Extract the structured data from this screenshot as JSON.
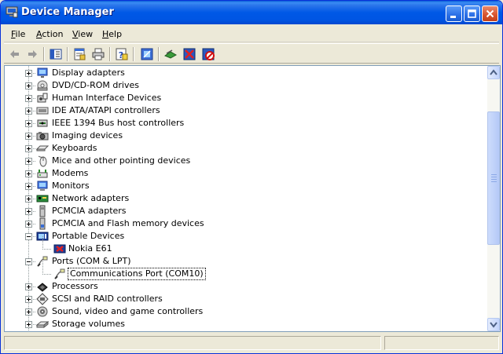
{
  "window": {
    "title": "Device Manager",
    "icon": "device-manager-icon",
    "controls": [
      "minimize",
      "maximize",
      "close"
    ]
  },
  "menu": [
    {
      "label": "File",
      "accel": "F",
      "rest": "ile"
    },
    {
      "label": "Action",
      "accel": "A",
      "rest": "ction"
    },
    {
      "label": "View",
      "accel": "V",
      "rest": "iew"
    },
    {
      "label": "Help",
      "accel": "H",
      "rest": "elp"
    }
  ],
  "toolbar": {
    "buttons": [
      "back-icon",
      "forward-icon",
      "show-hide-console-tree-icon",
      "properties-icon",
      "print-icon",
      "help-icon",
      "scan-hardware-icon",
      "update-driver-icon",
      "uninstall-icon",
      "disable-icon"
    ]
  },
  "tree": {
    "items": [
      {
        "label": "Display adapters",
        "icon": "display-adapter-icon",
        "level": 1,
        "state": "collapsed"
      },
      {
        "label": "DVD/CD-ROM drives",
        "icon": "cdrom-icon",
        "level": 1,
        "state": "collapsed"
      },
      {
        "label": "Human Interface Devices",
        "icon": "hid-icon",
        "level": 1,
        "state": "collapsed"
      },
      {
        "label": "IDE ATA/ATAPI controllers",
        "icon": "ide-controller-icon",
        "level": 1,
        "state": "collapsed"
      },
      {
        "label": "IEEE 1394 Bus host controllers",
        "icon": "ieee1394-icon",
        "level": 1,
        "state": "collapsed"
      },
      {
        "label": "Imaging devices",
        "icon": "imaging-device-icon",
        "level": 1,
        "state": "collapsed"
      },
      {
        "label": "Keyboards",
        "icon": "keyboard-icon",
        "level": 1,
        "state": "collapsed"
      },
      {
        "label": "Mice and other pointing devices",
        "icon": "mouse-icon",
        "level": 1,
        "state": "collapsed"
      },
      {
        "label": "Modems",
        "icon": "modem-icon",
        "level": 1,
        "state": "collapsed"
      },
      {
        "label": "Monitors",
        "icon": "monitor-icon",
        "level": 1,
        "state": "collapsed"
      },
      {
        "label": "Network adapters",
        "icon": "network-adapter-icon",
        "level": 1,
        "state": "collapsed"
      },
      {
        "label": "PCMCIA adapters",
        "icon": "pcmcia-icon",
        "level": 1,
        "state": "collapsed"
      },
      {
        "label": "PCMCIA and Flash memory devices",
        "icon": "flash-memory-icon",
        "level": 1,
        "state": "collapsed"
      },
      {
        "label": "Portable Devices",
        "icon": "portable-devices-icon",
        "level": 1,
        "state": "expanded"
      },
      {
        "label": "Nokia E61",
        "icon": "nokia-device-icon",
        "level": 2,
        "state": "leaf"
      },
      {
        "label": "Ports (COM & LPT)",
        "icon": "ports-icon",
        "level": 1,
        "state": "expanded"
      },
      {
        "label": "Communications Port (COM10)",
        "icon": "com-port-icon",
        "level": 2,
        "state": "leaf",
        "selected": true
      },
      {
        "label": "Processors",
        "icon": "processor-icon",
        "level": 1,
        "state": "collapsed"
      },
      {
        "label": "SCSI and RAID controllers",
        "icon": "scsi-icon",
        "level": 1,
        "state": "collapsed"
      },
      {
        "label": "Sound, video and game controllers",
        "icon": "sound-icon",
        "level": 1,
        "state": "collapsed"
      },
      {
        "label": "Storage volumes",
        "icon": "storage-volume-icon",
        "level": 1,
        "state": "collapsed"
      }
    ]
  },
  "colors": {
    "titlebar": "#0058e6",
    "selection_border": "#000000",
    "background": "#ece9d8"
  }
}
